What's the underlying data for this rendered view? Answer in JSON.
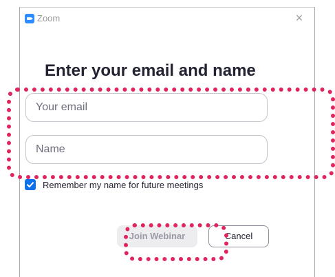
{
  "window": {
    "app_icon": "zoom-camera-icon",
    "title": "Zoom",
    "close_glyph": "×"
  },
  "form": {
    "heading": "Enter your email and name",
    "email": {
      "placeholder": "Your email",
      "value": ""
    },
    "name": {
      "placeholder": "Name",
      "value": ""
    },
    "remember": {
      "label": "Remember my name for future meetings",
      "checked": true
    }
  },
  "buttons": {
    "join_label": "Join Webinar",
    "join_enabled": false,
    "cancel_label": "Cancel"
  },
  "colors": {
    "accent": "#0e71eb",
    "zoom_blue": "#2d8cff",
    "highlight": "#e0245e"
  }
}
